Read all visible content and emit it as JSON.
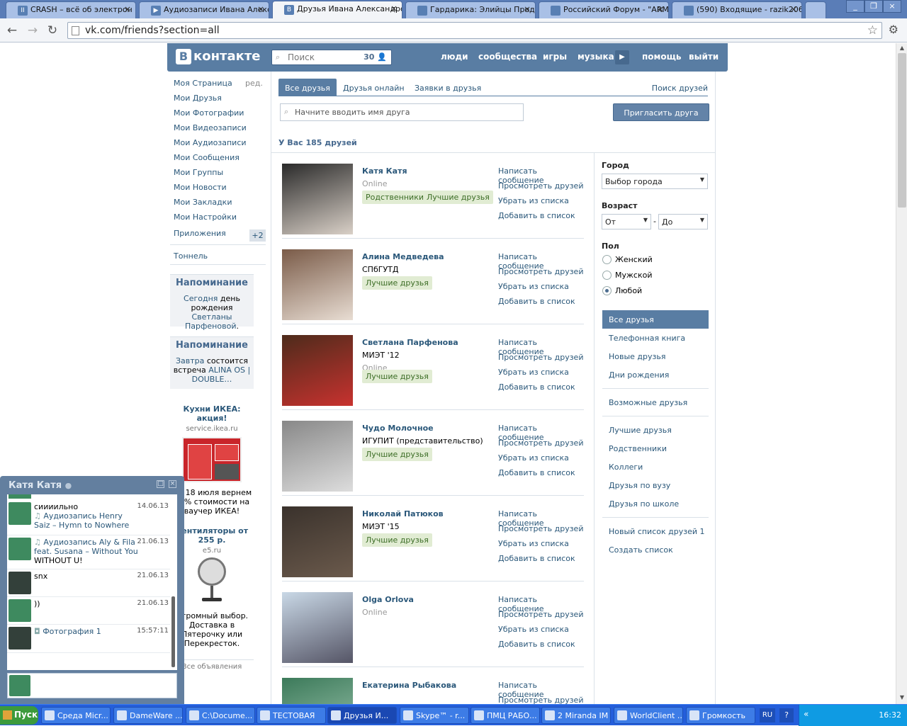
{
  "browser": {
    "tabs": [
      {
        "title": "CRASH – всё об электрон",
        "icon": "pause-icon"
      },
      {
        "title": "Аудиозаписи Ивана Алекс",
        "icon": "play-icon"
      },
      {
        "title": "Друзья Ивана Александро",
        "icon": "vk-icon",
        "active": true
      },
      {
        "title": "Гардарика: Элийцы Продо",
        "icon": "page-icon"
      },
      {
        "title": "Российский Форум - \"ARMI",
        "icon": "forum-icon"
      },
      {
        "title": "(590) Входящие - razik206",
        "icon": "mail-icon"
      }
    ],
    "url": "vk.com/friends?section=all"
  },
  "vk": {
    "logo": "контакте",
    "logo_letter": "В",
    "search_placeholder": "Поиск",
    "search_count": "30",
    "nav": [
      "люди",
      "сообщества",
      "игры",
      "музыка",
      "помощь",
      "выйти"
    ]
  },
  "left_menu": {
    "items": [
      "Моя Страница",
      "Мои Друзья",
      "Мои Фотографии",
      "Мои Видеозаписи",
      "Мои Аудиозаписи",
      "Мои Сообщения",
      "Мои Группы",
      "Мои Новости",
      "Мои Закладки",
      "Мои Настройки"
    ],
    "edit": "ред.",
    "apps": "Приложения",
    "apps_badge": "+2",
    "tunnel": "Тоннель"
  },
  "reminders": [
    {
      "title": "Напоминание",
      "link1": "Сегодня",
      "text1": " день рождения ",
      "link2": "Светланы Парфеновой",
      "text2": "."
    },
    {
      "title": "Напоминание",
      "link1": "Завтра",
      "text1": " состоится встреча ",
      "link2": "ALINA OS | DOUBLE…",
      "text2": ""
    }
  ],
  "ads": [
    {
      "title": "Кухни ИКЕА: акция!",
      "site": "service.ikea.ru",
      "text": "До 18 июля вернем 15% стоимости на ваучер ИКЕА!"
    },
    {
      "title": "Вентиляторы от 255 р.",
      "site": "e5.ru",
      "text": "Огромный выбор. Доставка в Пятерочку или Перекресток."
    }
  ],
  "ads_all": "Все объявления",
  "friends_page": {
    "tabs": [
      "Все друзья",
      "Друзья онлайн",
      "Заявки в друзья"
    ],
    "find": "Поиск друзей",
    "search_placeholder": "Начните вводить имя друга",
    "invite": "Пригласить друга",
    "summary": "У Вас 185 друзей",
    "actions": [
      "Написать сообщение",
      "Просмотреть друзей",
      "Убрать из списка",
      "Добавить в список"
    ],
    "friends": [
      {
        "name": "Катя Катя",
        "line1": "",
        "status": "Online",
        "badges": [
          "Родственники",
          "Лучшие друзья"
        ]
      },
      {
        "name": "Алина Медведева",
        "line1": "СПбГУТД",
        "status": "",
        "badges": [
          "Лучшие друзья"
        ]
      },
      {
        "name": "Светлана Парфенова",
        "line1": "МИЭТ '12",
        "status": "Online",
        "badges": [
          "Лучшие друзья"
        ]
      },
      {
        "name": "Чудо Молочное",
        "line1": "ИГУПИТ (представительство)",
        "status": "",
        "badges": [
          "Лучшие друзья"
        ]
      },
      {
        "name": "Николай Патюков",
        "line1": "МИЭТ '15",
        "status": "",
        "badges": [
          "Лучшие друзья"
        ]
      },
      {
        "name": "Olga Orlova",
        "line1": "",
        "status": "Online",
        "badges": []
      },
      {
        "name": "Екатерина Рыбакова",
        "line1": "",
        "status": "",
        "badges": []
      }
    ]
  },
  "filter": {
    "city_label": "Город",
    "city_value": "Выбор города",
    "age_label": "Возраст",
    "age_from": "От",
    "age_dash": "-",
    "age_to": "До",
    "sex_label": "Пол",
    "sex_options": [
      "Женский",
      "Мужской",
      "Любой"
    ],
    "sex_selected": "Любой",
    "lists_a": [
      "Все друзья",
      "Телефонная книга",
      "Новые друзья",
      "Дни рождения"
    ],
    "lists_b": [
      "Возможные друзья"
    ],
    "lists_c": [
      "Лучшие друзья",
      "Родственники",
      "Коллеги",
      "Друзья по вузу",
      "Друзья по школе"
    ],
    "lists_d": [
      "Новый список друзей 1",
      "Создать список"
    ]
  },
  "chat": {
    "title": "Катя Катя",
    "messages": [
      {
        "text": "сиииильно",
        "link": "Аудиозапись Henry Saiz – Hymn to Nowhere",
        "time": "14.06.13",
        "avatar": "group-avatar"
      },
      {
        "text": "",
        "link": "Аудиозапись Aly & Fila feat. Susana – Without You",
        "extra": "WITHOUT U!",
        "time": "21.06.13",
        "avatar": "group-avatar"
      },
      {
        "text": "snx",
        "link": "",
        "time": "21.06.13",
        "avatar": "user-avatar"
      },
      {
        "text": "))",
        "link": "",
        "time": "21.06.13",
        "avatar": "group-avatar"
      },
      {
        "text": "",
        "link": "Фотография 1",
        "time": "15:57:11",
        "avatar": "user-avatar"
      }
    ]
  },
  "taskbar": {
    "start": "Пуск",
    "items": [
      "Среда Micr...",
      "DameWare ...",
      "C:\\Docume...",
      "ТЕСТОВАЯ",
      "Друзья И...",
      "Skype™ - r...",
      "ПМЦ РАБО...",
      "2 Miranda IM",
      "WorldClient ...",
      "Громкость"
    ],
    "lang": "RU",
    "clock": "16:32"
  }
}
